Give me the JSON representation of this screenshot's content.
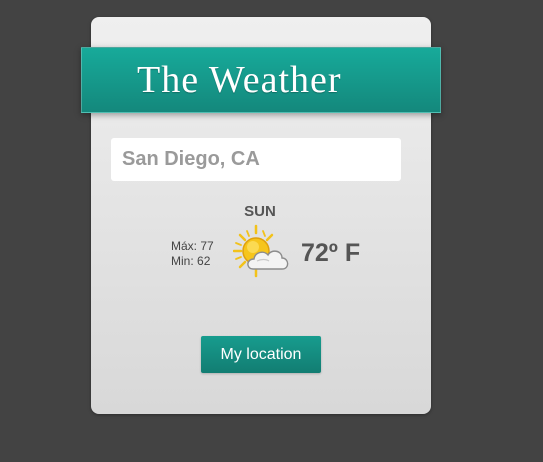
{
  "header": {
    "title": "The Weather"
  },
  "search": {
    "value": "San Diego, CA"
  },
  "forecast": {
    "day": "SUN",
    "max_label": "Máx:",
    "max_value": "77",
    "min_label": "Min:",
    "min_value": "62",
    "temperature": "72º F",
    "icon": "partly-cloudy-icon"
  },
  "actions": {
    "location_button_label": "My location"
  },
  "colors": {
    "background": "#434343",
    "accent": "#17aa9a",
    "card": "#e6e6e6"
  }
}
